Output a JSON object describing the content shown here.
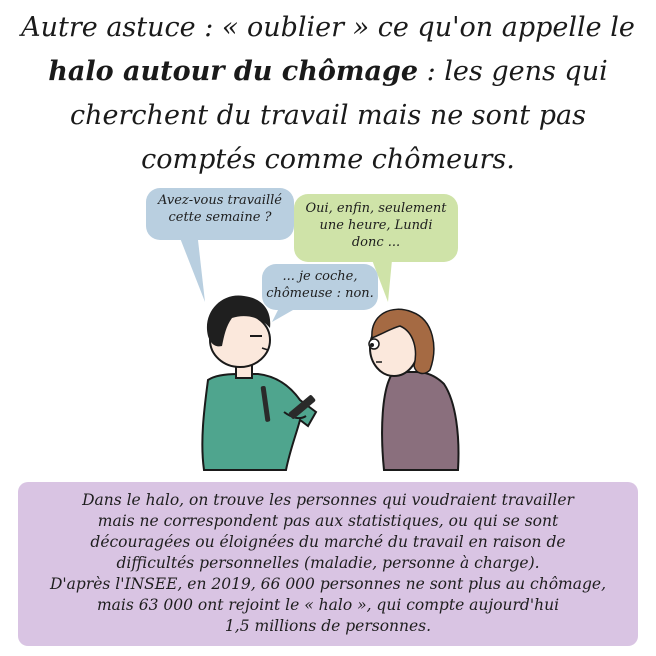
{
  "headline": {
    "line1": "Autre astuce : « oublier » ce qu'on appelle le",
    "line2_bold": "halo autour du chômage",
    "line2_rest": " : les gens qui",
    "line3": "cherchent du travail mais ne sont pas",
    "line4": "comptés comme chômeurs."
  },
  "bubbles": {
    "interviewer": [
      "Avez-vous travaillé",
      "cette semaine ?"
    ],
    "respondent": [
      "Oui, enfin, seulement",
      "une heure, Lundi",
      "donc ..."
    ],
    "interviewer_reply": [
      "... je coche,",
      "chômeuse : non."
    ]
  },
  "caption": {
    "lines": [
      "Dans le halo, on trouve les personnes qui voudraient travailler",
      "mais ne correspondent pas aux statistiques, ou qui se sont",
      "découragées ou éloignées du marché du travail en raison de",
      "difficultés personnelles (maladie, personne à charge).",
      "D'après l'INSEE, en 2019, 66 000 personnes ne sont plus au chômage,",
      "mais 63 000 ont rejoint le « halo », qui compte aujourd'hui",
      "1,5 millions de personnes."
    ]
  },
  "colors": {
    "bubble_blue": "#b9cfe0",
    "bubble_green": "#cfe3a8",
    "caption_purple": "#d9c4e3",
    "shirt_teal": "#4fa58e",
    "sweater_mauve": "#8a6f7d"
  }
}
